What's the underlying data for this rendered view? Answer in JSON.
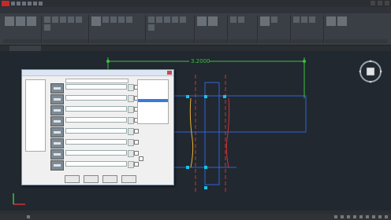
{
  "app": {
    "title": "",
    "colors": {
      "background": "#212830",
      "ribbon": "#3a3f45",
      "dimension": "#3fbf3f",
      "geometry": "#2f64d8",
      "grips": "#19c3e6",
      "centerlines": "#d23232",
      "highlight": "#e8b432"
    }
  },
  "ribbon": {
    "tabs": [
      "",
      "",
      "",
      "",
      "",
      "",
      "",
      "",
      "",
      "",
      "",
      "",
      ""
    ],
    "groups": [
      "",
      "",
      "",
      "",
      "",
      "",
      "",
      "",
      ""
    ]
  },
  "filetab": {
    "label": ""
  },
  "drawing": {
    "dimension_text": "3.2000"
  },
  "dialog": {
    "title": "",
    "top_field": "",
    "left_list": [
      "",
      "",
      ""
    ],
    "rows": [
      {
        "value": ""
      },
      {
        "value": ""
      },
      {
        "value": ""
      },
      {
        "value": ""
      },
      {
        "value": ""
      },
      {
        "value": ""
      },
      {
        "value": ""
      },
      {
        "value": ""
      }
    ],
    "right_list": [
      "",
      "",
      "",
      "",
      "",
      "",
      "",
      "",
      "",
      "",
      "",
      ""
    ],
    "option_label": "",
    "bottom_label": "",
    "buttons": [
      "",
      "",
      "",
      ""
    ]
  },
  "statusbar": {
    "tabs": [
      "",
      "",
      ""
    ]
  }
}
